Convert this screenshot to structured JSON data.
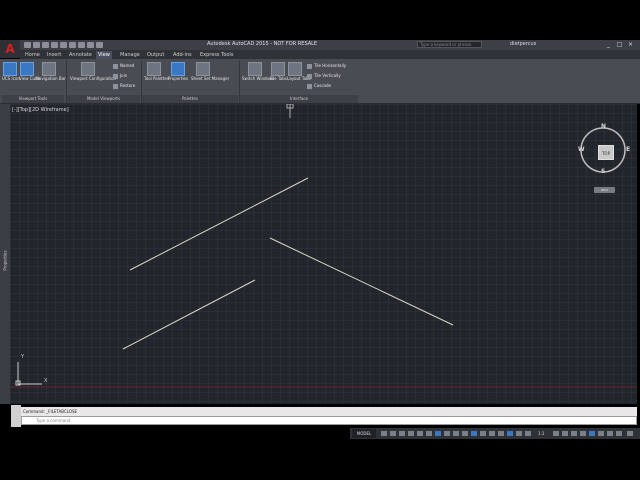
{
  "titlebar": {
    "app_letter": "A",
    "title": "Autodesk AutoCAD 2015 - NOT FOR RESALE",
    "search_placeholder": "Type a keyword or phrase",
    "user": "dietpercus",
    "min": "_",
    "max": "□",
    "close": "×"
  },
  "tabs": [
    {
      "label": "Home"
    },
    {
      "label": "Insert"
    },
    {
      "label": "Annotate"
    },
    {
      "label": "View",
      "active": true
    },
    {
      "label": "Manage"
    },
    {
      "label": "Output"
    },
    {
      "label": "Add-ins"
    },
    {
      "label": "Express Tools"
    }
  ],
  "ribbon": {
    "ucs_icon": "UCS Icon",
    "view_cube": "View Cube",
    "nav_bar": "Navigation Bar",
    "viewport_config": "Viewport Configuration",
    "named": "Named",
    "join": "Join",
    "restore": "Restore",
    "tool_palettes": "Tool Palettes",
    "properties": "Properties",
    "sheet_set": "Sheet Set Manager",
    "switch_windows": "Switch Windows",
    "file_tabs": "File Tabs",
    "layout_tabs": "Layout Tabs",
    "tile_horizontally": "Tile Horizontally",
    "tile_vertically": "Tile Vertically",
    "cascade": "Cascade",
    "panels": {
      "viewport_tools": "Viewport Tools",
      "model_viewports": "Model Viewports",
      "palettes": "Palettes",
      "interface": "Interface"
    }
  },
  "viewport": {
    "label": "[-][Top][2D Wireframe]",
    "palette_label": "Properties",
    "viewcube_face": "TOP",
    "compass": {
      "n": "N",
      "s": "S",
      "e": "E",
      "w": "W"
    },
    "wcs": "WCS",
    "ucs_y": "Y",
    "ucs_x": "X"
  },
  "command": {
    "history": "Command: _FILETABCLOSE",
    "placeholder": "Type a command"
  },
  "status": {
    "model": "MODEL",
    "scale": "1:1"
  },
  "colors": {
    "accent": "#3b78c4",
    "canvas": "#22252b",
    "line": "#d8d8c8"
  }
}
